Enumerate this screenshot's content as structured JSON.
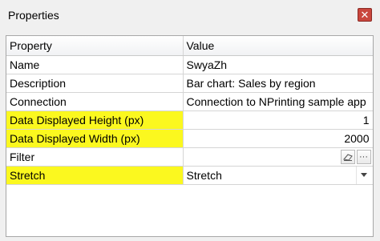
{
  "window": {
    "title": "Properties"
  },
  "grid": {
    "columns": [
      "Property",
      "Value"
    ],
    "rows": [
      {
        "property": "Name",
        "value": "SwyaZh"
      },
      {
        "property": "Description",
        "value": "Bar chart: Sales by region"
      },
      {
        "property": "Connection",
        "value": "Connection to NPrinting sample app"
      },
      {
        "property": "Data Displayed Height (px)",
        "value": "1"
      },
      {
        "property": "Data Displayed Width (px)",
        "value": "2000"
      },
      {
        "property": "Filter",
        "value": ""
      },
      {
        "property": "Stretch",
        "value": "Stretch"
      }
    ]
  },
  "icons": {
    "close": "close-icon",
    "eraser": "eraser-icon",
    "ellipsis": "ellipsis-icon",
    "dropdown": "chevron-down-icon"
  },
  "colors": {
    "highlight": "#fbf81f",
    "close_button": "#c9463d"
  }
}
